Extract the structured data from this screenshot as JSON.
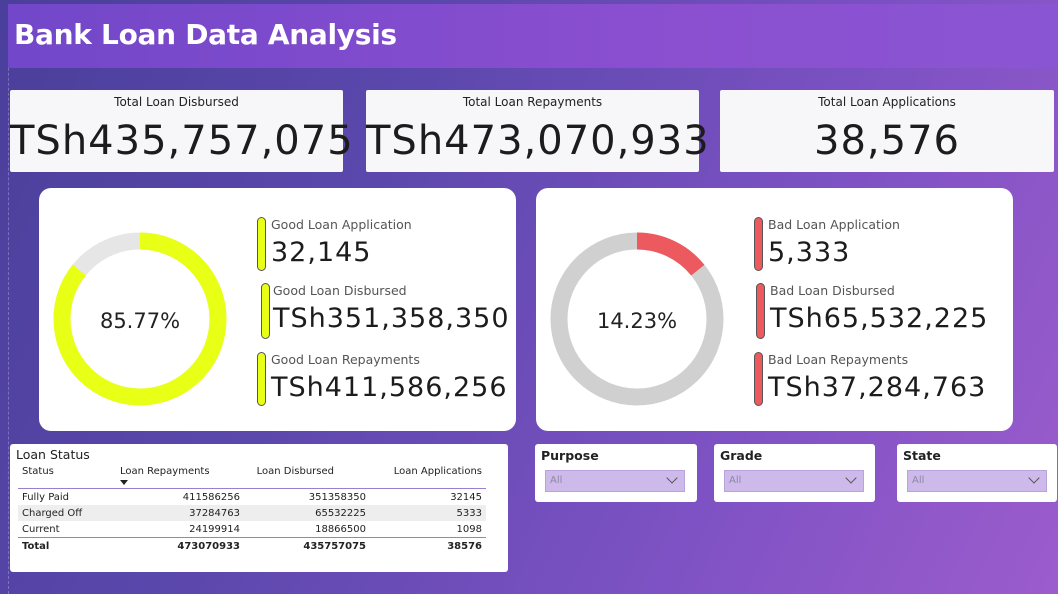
{
  "header": {
    "title": "Bank Loan Data Analysis"
  },
  "kpis": [
    {
      "title": "Total Loan Disbursed",
      "value": "TSh435,757,075"
    },
    {
      "title": "Total Loan Repayments",
      "value": "TSh473,070,933"
    },
    {
      "title": "Total Loan Applications",
      "value": "38,576"
    }
  ],
  "good": {
    "percent_label": "85.77%",
    "percent": 85.77,
    "accent": "#e8ff16",
    "track": "#e6e6e6",
    "metrics": [
      {
        "label": "Good Loan Application",
        "value": "32,145"
      },
      {
        "label": "Good Loan Disbursed",
        "value": "TSh351,358,350"
      },
      {
        "label": "Good Loan Repayments",
        "value": "TSh411,586,256"
      }
    ]
  },
  "bad": {
    "percent_label": "14.23%",
    "percent": 14.23,
    "accent": "#ec5a5f",
    "track": "#d0d0d0",
    "metrics": [
      {
        "label": "Bad Loan Application",
        "value": "5,333"
      },
      {
        "label": "Bad Loan Disbursed",
        "value": "TSh65,532,225"
      },
      {
        "label": "Bad Loan Repayments",
        "value": "TSh37,284,763"
      }
    ]
  },
  "loan_status": {
    "title": "Loan Status",
    "columns": [
      "Status",
      "Loan Repayments",
      "Loan Disbursed",
      "Loan Applications"
    ],
    "rows": [
      [
        "Fully Paid",
        "411586256",
        "351358350",
        "32145"
      ],
      [
        "Charged Off",
        "37284763",
        "65532225",
        "5333"
      ],
      [
        "Current",
        "24199914",
        "18866500",
        "1098"
      ]
    ],
    "total": [
      "Total",
      "473070933",
      "435757075",
      "38576"
    ]
  },
  "slicers": [
    {
      "title": "Purpose",
      "value": "All"
    },
    {
      "title": "Grade",
      "value": "All"
    },
    {
      "title": "State",
      "value": "All"
    }
  ]
}
